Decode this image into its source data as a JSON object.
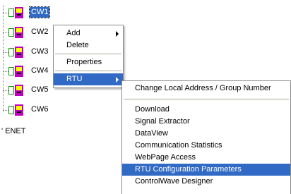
{
  "tree": {
    "items": [
      {
        "label": "CW1",
        "selected": true
      },
      {
        "label": "CW2"
      },
      {
        "label": "CW3"
      },
      {
        "label": "CW4"
      },
      {
        "label": "CW5"
      },
      {
        "label": "CW6"
      }
    ],
    "enet_label": "' ENET",
    "icon": "rtu-device-icon",
    "icon_colors": {
      "body": "#c000c0",
      "face": "#ffff00",
      "pins": "#00a000"
    }
  },
  "context_menu": {
    "items": [
      {
        "label": "Add",
        "has_submenu": true
      },
      {
        "label": "Delete"
      },
      {
        "label": "Properties"
      },
      {
        "label": "RTU",
        "has_submenu": true,
        "highlighted": true
      }
    ]
  },
  "rtu_submenu": {
    "items": [
      {
        "label": "Change Local Address / Group Number"
      },
      {
        "label": "Download"
      },
      {
        "label": "Signal Extractor"
      },
      {
        "label": "DataView"
      },
      {
        "label": "Communication Statistics"
      },
      {
        "label": "WebPage Access"
      },
      {
        "label": "RTU Configuration Parameters",
        "highlighted": true
      },
      {
        "label": "ControlWave Designer"
      }
    ]
  },
  "colors": {
    "highlight": "#316ac5",
    "highlight_text": "#ffffff"
  }
}
